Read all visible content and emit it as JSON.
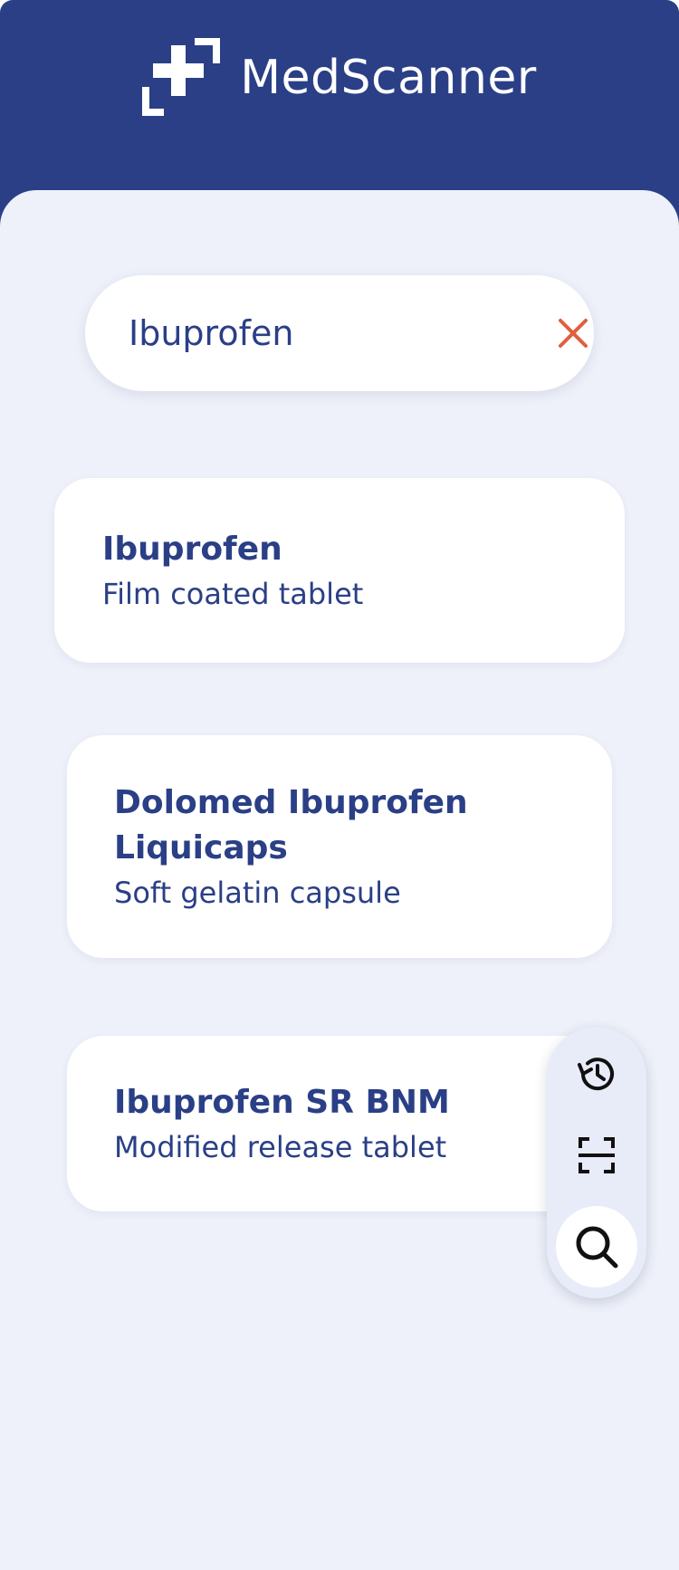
{
  "app": {
    "title": "MedScanner",
    "colors": {
      "header": "#2a3f86",
      "background": "#eef1fa",
      "accent_clear": "#e0603e",
      "text": "#2a3f86"
    }
  },
  "search": {
    "value": "Ibuprofen",
    "placeholder": "",
    "clear_icon": "close-icon"
  },
  "results": [
    {
      "name": "Ibuprofen",
      "form": "Film coated tablet"
    },
    {
      "name": "Dolomed Ibuprofen Liquicaps",
      "form": "Soft gelatin capsule"
    },
    {
      "name": "Ibuprofen SR BNM",
      "form": "Modified release tablet"
    }
  ],
  "fab_menu": {
    "items": [
      {
        "icon": "history-icon"
      },
      {
        "icon": "scan-icon"
      },
      {
        "icon": "search-icon"
      }
    ]
  }
}
